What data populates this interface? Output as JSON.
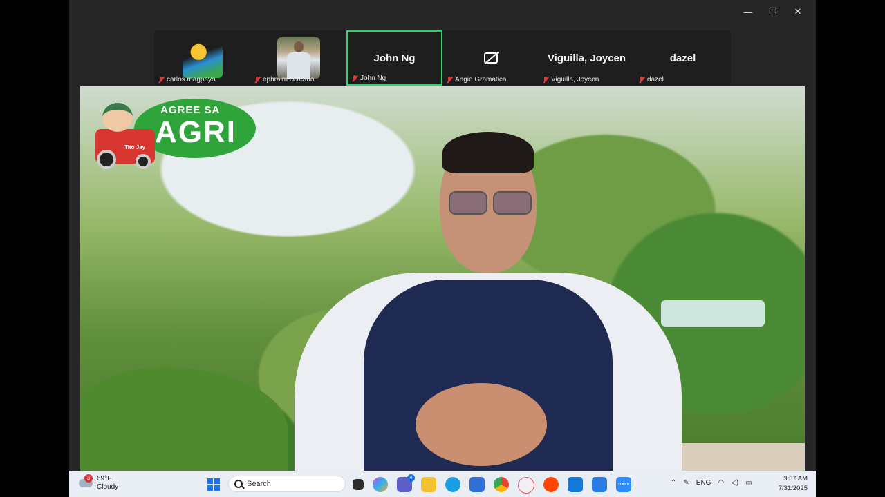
{
  "window": {
    "controls": {
      "minimize": "—",
      "restore": "❐",
      "close": "✕"
    }
  },
  "participants": [
    {
      "name": "carlos magpayo",
      "display": "avatar",
      "avatar": "sun-globe-avatar",
      "muted": true
    },
    {
      "name": "ephraim cercado",
      "display": "photo",
      "avatar": "profile-photo",
      "muted": true
    },
    {
      "name": "John Ng",
      "display": "name",
      "big_label": "John Ng",
      "muted": true,
      "active_speaker": true
    },
    {
      "name": "Angie Gramatica",
      "display": "camera-off",
      "avatar": "camera-off-icon",
      "muted": true
    },
    {
      "name": "Viguilla, Joycen",
      "display": "name",
      "big_label": "Viguilla, Joycen",
      "muted": true
    },
    {
      "name": "dazel",
      "display": "name",
      "big_label": "dazel",
      "muted": true
    }
  ],
  "video": {
    "logo": {
      "line1": "AGREE SA",
      "line2": "AGRI",
      "mascot_tag": "Tito Jay"
    }
  },
  "taskbar": {
    "weather": {
      "temp": "69°F",
      "condition": "Cloudy",
      "badge": "3"
    },
    "search_placeholder": "Search",
    "apps": [
      {
        "name": "task-view-icon",
        "color": "#2b2b2b"
      },
      {
        "name": "copilot-icon",
        "color": "#c54ad8"
      },
      {
        "name": "teams-icon",
        "color": "#5b5fc7",
        "count": "4"
      },
      {
        "name": "file-explorer-icon",
        "color": "#f2c230"
      },
      {
        "name": "edge-icon",
        "color": "#1b9de2"
      },
      {
        "name": "store-icon",
        "color": "#2f6fd6"
      },
      {
        "name": "chrome-icon",
        "color": "#e54335"
      },
      {
        "name": "app-q-icon",
        "color": "#e8e8ee"
      },
      {
        "name": "reddit-icon",
        "color": "#ff4500"
      },
      {
        "name": "outlook-icon",
        "color": "#1479d6"
      },
      {
        "name": "calendar-icon",
        "color": "#2b7be4"
      },
      {
        "name": "zoom-icon",
        "color": "#2d8cff",
        "label": "zoom"
      }
    ],
    "tray": {
      "language": "ENG"
    },
    "clock": {
      "time": "3:57 AM",
      "date": "7/31/2025"
    }
  }
}
